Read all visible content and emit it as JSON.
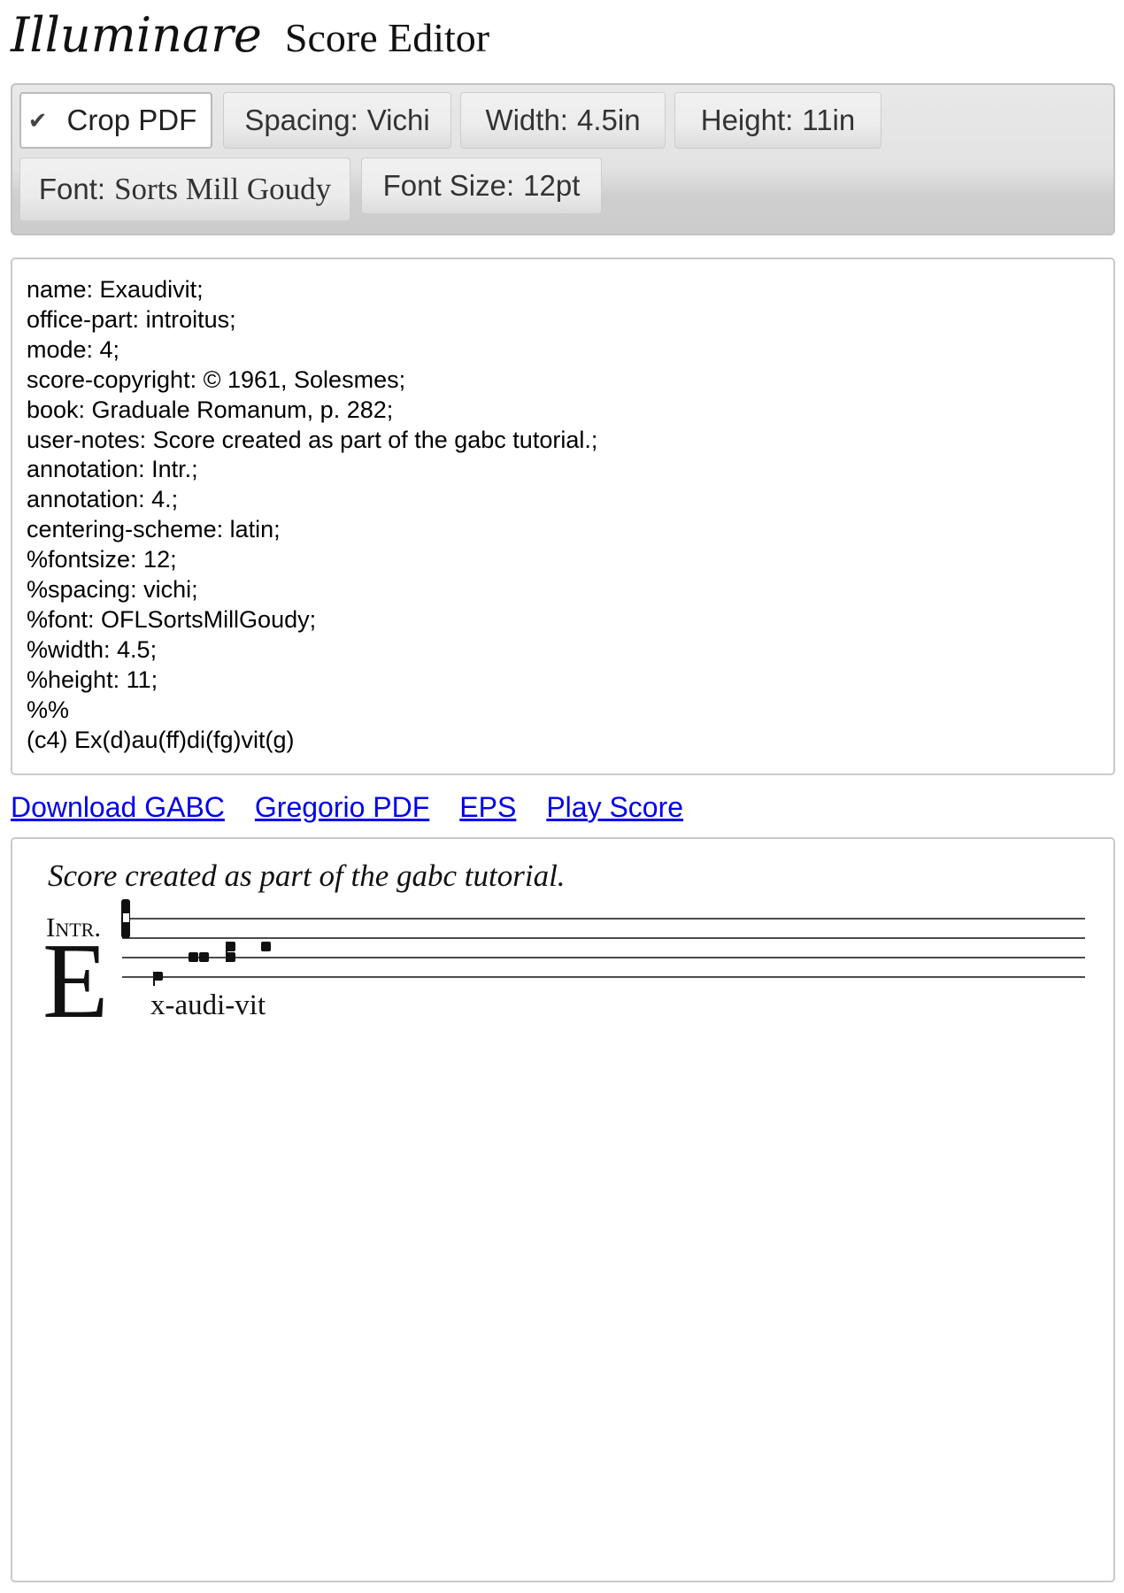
{
  "header": {
    "brand": "Illuminare",
    "app_name": "Score Editor"
  },
  "toolbar": {
    "crop": {
      "label": "Crop PDF",
      "checked": true,
      "icon": "check-icon"
    },
    "spacing": {
      "key": "Spacing:",
      "value": "Vichi"
    },
    "width": {
      "key": "Width:",
      "value": "4.5in"
    },
    "height": {
      "key": "Height:",
      "value": "11in"
    },
    "font": {
      "key": "Font:",
      "value": "Sorts Mill Goudy"
    },
    "font_size": {
      "key": "Font Size:",
      "value": "12pt"
    }
  },
  "editor": {
    "content": "name: Exaudivit;\noffice-part: introitus;\nmode: 4;\nscore-copyright: © 1961, Solesmes;\nbook: Graduale Romanum, p. 282;\nuser-notes: Score created as part of the gabc tutorial.;\nannotation: Intr.;\nannotation: 4.;\ncentering-scheme: latin;\n%fontsize: 12;\n%spacing: vichi;\n%font: OFLSortsMillGoudy;\n%width: 4.5;\n%height: 11;\n%%\n(c4) Ex(d)au(ff)di(fg)vit(g)"
  },
  "links": {
    "download_gabc": "Download GABC",
    "gregorio_pdf": "Gregorio PDF",
    "eps": "EPS",
    "play_score": "Play Score"
  },
  "preview": {
    "user_notes": "Score created as part of the gabc tutorial.",
    "annotation": "Intr.",
    "initial": "E",
    "lyrics": "x-audi-vit",
    "clef": "c4",
    "neumes": [
      "d",
      "ff",
      "fg",
      "g"
    ]
  },
  "colors": {
    "link": "#0000ee",
    "toolbar_bg": "#e3e3e3",
    "border": "#c9c9c9"
  }
}
